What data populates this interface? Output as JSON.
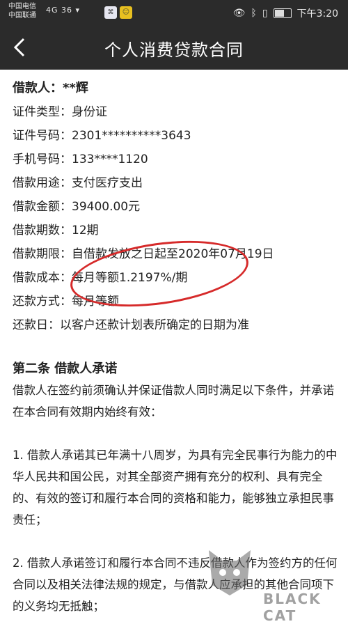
{
  "status_bar": {
    "carrier1": "中国电信",
    "carrier2": "中国联通",
    "signal": "4G 36 ▾",
    "time": "下午3:20"
  },
  "nav": {
    "back_icon": "chevron-left-icon",
    "title": "个人消费贷款合同"
  },
  "fields": [
    {
      "label": "借款人：",
      "value": "**辉"
    },
    {
      "label": "证件类型：",
      "value": "身份证"
    },
    {
      "label": "证件号码：",
      "value": "2301**********3643"
    },
    {
      "label": "手机号码：",
      "value": "133****1120"
    },
    {
      "label": "借款用途：",
      "value": "支付医疗支出"
    },
    {
      "label": "借款金额：",
      "value": "39400.00元"
    },
    {
      "label": "借款期数：",
      "value": "12期"
    },
    {
      "label": "借款期限：",
      "value": "自借款发放之日起至2020年07月19日"
    },
    {
      "label": "借款成本：",
      "value": "每月等额1.2197%/期"
    },
    {
      "label": "还款方式：",
      "value": "每月等额"
    },
    {
      "label": "还款日：",
      "value": "以客户还款计划表所确定的日期为准"
    }
  ],
  "section_title": "第二条 借款人承诺",
  "paragraph1": "借款人在签约前须确认并保证借款人同时满足以下条件，并承诺在本合同有效期内始终有效：",
  "paragraph2": "1. 借款人承诺其已年满十八周岁，为具有完全民事行为能力的中华人民共和国公民，对其全部资产拥有充分的权利、具有完全的、有效的签订和履行本合同的资格和能力，能够独立承担民事责任；",
  "paragraph3": "2. 借款人承诺签订和履行本合同不违反借款人作为签约方的任何合同以及相关法律法规的规定，与借款人应承担的其他合同项下的义务均无抵触；",
  "watermark": {
    "text": "BLACK CAT",
    "logo_text": "黑猫"
  },
  "colors": {
    "bar_bg": "#2b2b2b",
    "annotation_red": "#d62a2a"
  }
}
